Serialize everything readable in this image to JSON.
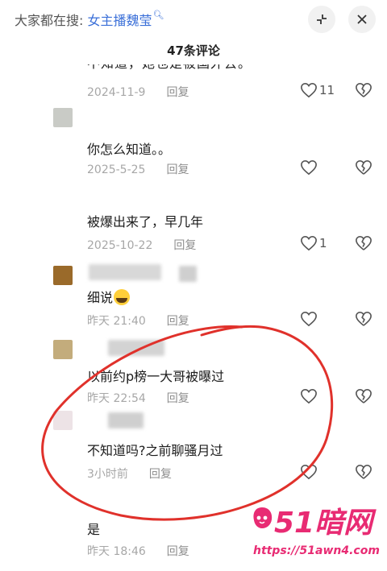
{
  "header": {
    "search_prefix": "大家都在搜:",
    "search_keyword": "女主播魏莹",
    "title": "47条评论"
  },
  "partial_text": "不知道，她也是被国外去。",
  "comments": [
    {
      "text": "",
      "date": "2024-11-9",
      "reply": "回复",
      "likes": "11"
    },
    {
      "text": "你怎么知道。。",
      "date": "2025-5-25",
      "reply": "回复",
      "likes": ""
    },
    {
      "text": "被爆出来了，早几年",
      "date": "2025-10-22",
      "reply": "回复",
      "likes": "1"
    },
    {
      "text": "细说",
      "date": "昨天 21:40",
      "reply": "回复",
      "likes": ""
    },
    {
      "text": "以前约p榜一大哥被曝过",
      "date": "昨天 22:54",
      "reply": "回复",
      "likes": ""
    },
    {
      "text": "不知道吗?之前聊骚月过",
      "date": "3小时前",
      "reply": "回复",
      "likes": ""
    },
    {
      "text": "是",
      "date": "昨天 18:46",
      "reply": "回复",
      "likes": ""
    }
  ],
  "watermark": {
    "logo": "51暗网",
    "url": "https://51awn4.com"
  },
  "colors": {
    "accent": "#3a6fd8",
    "annotation": "#e0312b",
    "watermark": "#e82b73"
  }
}
